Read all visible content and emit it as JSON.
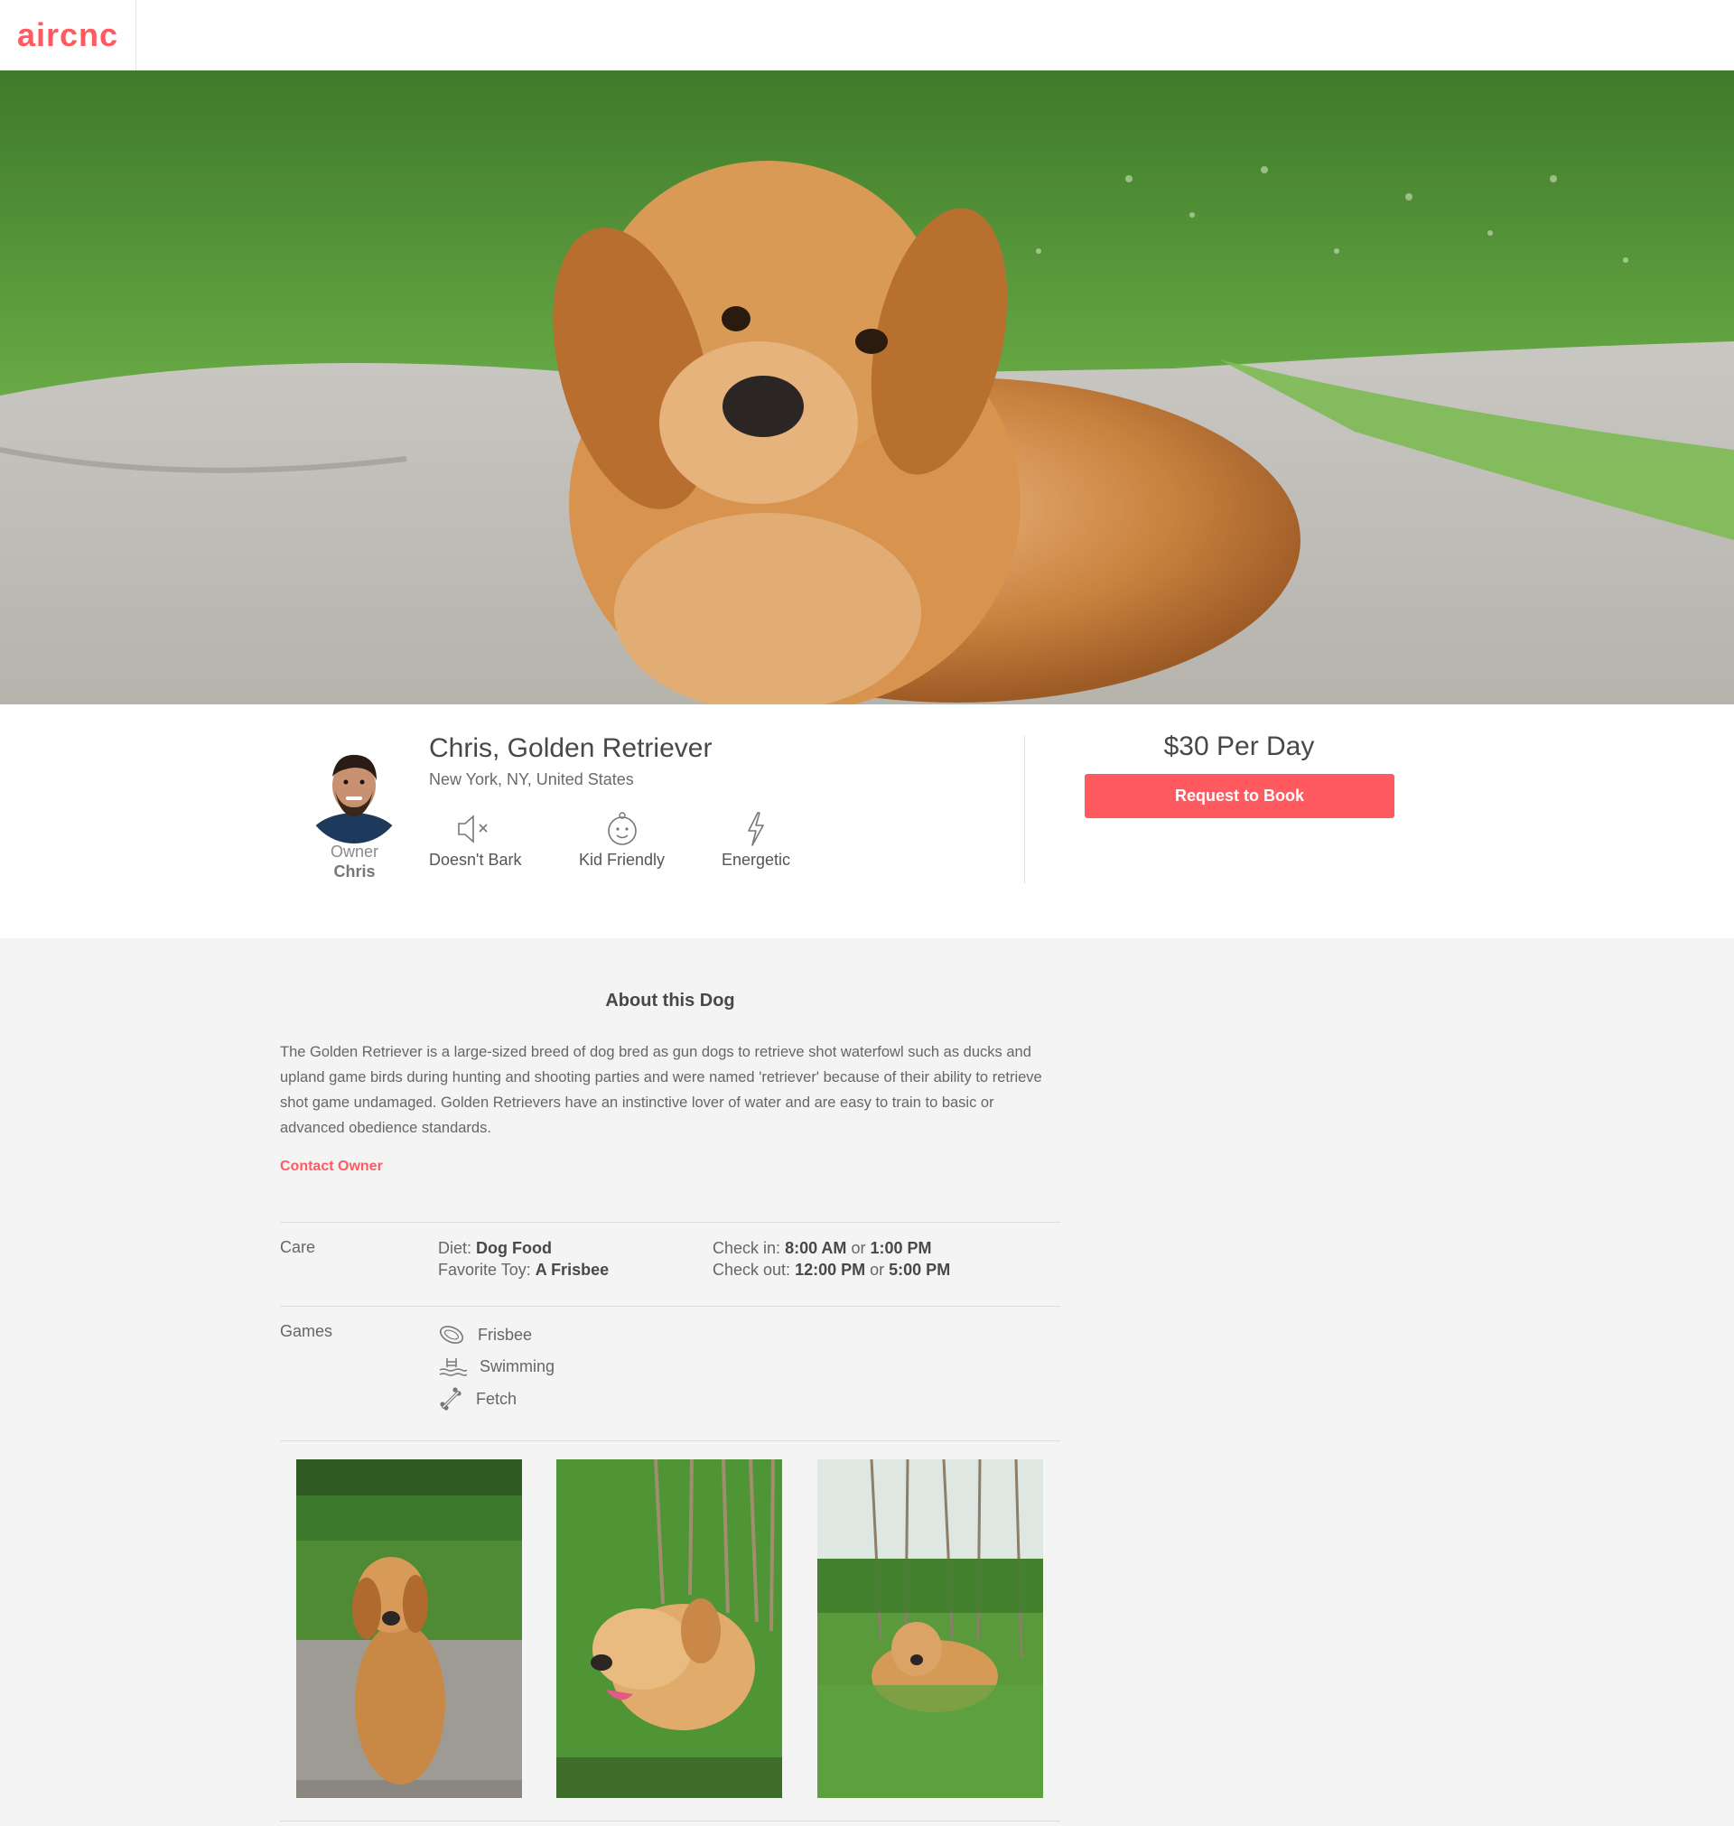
{
  "nav": {
    "logo": "aircnc"
  },
  "hero": {
    "image_desc": "golden retriever lying on pavement with grass"
  },
  "owner": {
    "label": "Owner",
    "name": "Chris"
  },
  "listing": {
    "title": "Chris, Golden Retriever",
    "location": "New York, NY, United States",
    "traits": [
      {
        "label": "Doesn't Bark",
        "icon": "muted-speaker-icon"
      },
      {
        "label": "Kid Friendly",
        "icon": "baby-face-icon"
      },
      {
        "label": "Energetic",
        "icon": "lightning-icon"
      }
    ],
    "price": "$30 Per Day",
    "book_label": "Request to Book"
  },
  "about": {
    "title": "About this Dog",
    "description": "The Golden Retriever is a large-sized breed of dog bred as gun dogs to retrieve shot waterfowl such as ducks and upland game birds during hunting and shooting parties and were named 'retriever' because of their ability to retrieve shot game undamaged. Golden Retrievers have an instinctive lover of water and are easy to train to basic or advanced obedience standards.",
    "contact_label": "Contact Owner"
  },
  "care": {
    "label": "Care",
    "diet_key": "Diet:",
    "diet_val": "Dog Food",
    "toy_key": "Favorite Toy:",
    "toy_val": "A Frisbee",
    "checkin_key": "Check in:",
    "checkin_a": "8:00 AM",
    "checkin_or": "or",
    "checkin_b": "1:00 PM",
    "checkout_key": "Check out:",
    "checkout_a": "12:00 PM",
    "checkout_or": "or",
    "checkout_b": "5:00 PM"
  },
  "games": {
    "label": "Games",
    "items": [
      {
        "label": "Frisbee",
        "icon": "frisbee-icon"
      },
      {
        "label": "Swimming",
        "icon": "swimming-icon"
      },
      {
        "label": "Fetch",
        "icon": "bone-icon"
      }
    ]
  },
  "colors": {
    "accent": "#ff5a5f",
    "text": "#484848",
    "muted": "#666666",
    "panel": "#f4f4f4"
  }
}
